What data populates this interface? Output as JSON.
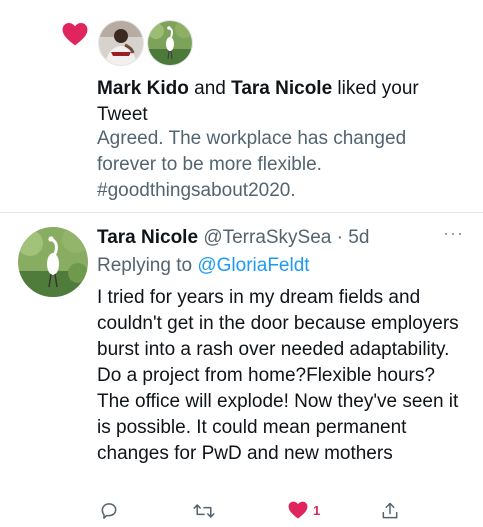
{
  "notification": {
    "icon": "heart-icon",
    "liker1": "Mark Kido",
    "conj": " and ",
    "liker2": "Tara Nicole",
    "action_text": " liked your Tweet",
    "quote": "Agreed. The workplace has changed forever to be more flexible. #goodthingsabout2020."
  },
  "tweet": {
    "name": "Tara Nicole",
    "handle": "@TerraSkySea",
    "separator": " · ",
    "time": "5d",
    "more": "···",
    "replying_prefix": "Replying to ",
    "replying_handle": "@GloriaFeldt",
    "body": "I tried for years in my dream fields and couldn't get in the door because employers burst into a rash over needed adaptability. Do a project from home?Flexible hours? The office will explode! Now they've seen it is possible. It could mean permanent changes for PwD and new mothers",
    "like_count": "1"
  },
  "colors": {
    "like_red": "#e0245e",
    "link_blue": "#1d9bf0",
    "secondary_gray": "#536471"
  }
}
